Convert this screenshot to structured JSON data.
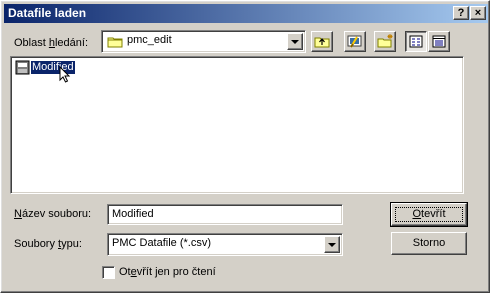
{
  "window": {
    "title": "Datafile laden",
    "help_label": "?",
    "close_label": "×"
  },
  "look_in": {
    "label_pre": "Oblast ",
    "label_hotkey": "h",
    "label_post": "ledání:",
    "value": "pmc_edit"
  },
  "toolbar": {
    "icons": [
      "up-one-level-icon",
      "desktop-icon",
      "new-folder-icon",
      "list-view-icon",
      "details-view-icon"
    ]
  },
  "file_list": {
    "items": [
      {
        "name": "Modified",
        "icon": "data-file-icon",
        "selected": true
      }
    ]
  },
  "file_name": {
    "label_hotkey": "N",
    "label_post": "ázev souboru:",
    "value": "Modified"
  },
  "file_type": {
    "label_pre": "Soubory ",
    "label_hotkey": "t",
    "label_post": "ypu:",
    "value": "PMC Datafile (*.csv)"
  },
  "buttons": {
    "open_hotkey": "O",
    "open_post": "tevřít",
    "cancel_label": "Storno"
  },
  "read_only": {
    "label_pre": "Ot",
    "label_hotkey": "e",
    "label_post": "vřít jen pro čtení",
    "checked": false
  },
  "colors": {
    "face": "#d4d0c8",
    "title_start": "#0a246a",
    "title_end": "#a6caf0",
    "selection": "#0a246a"
  }
}
